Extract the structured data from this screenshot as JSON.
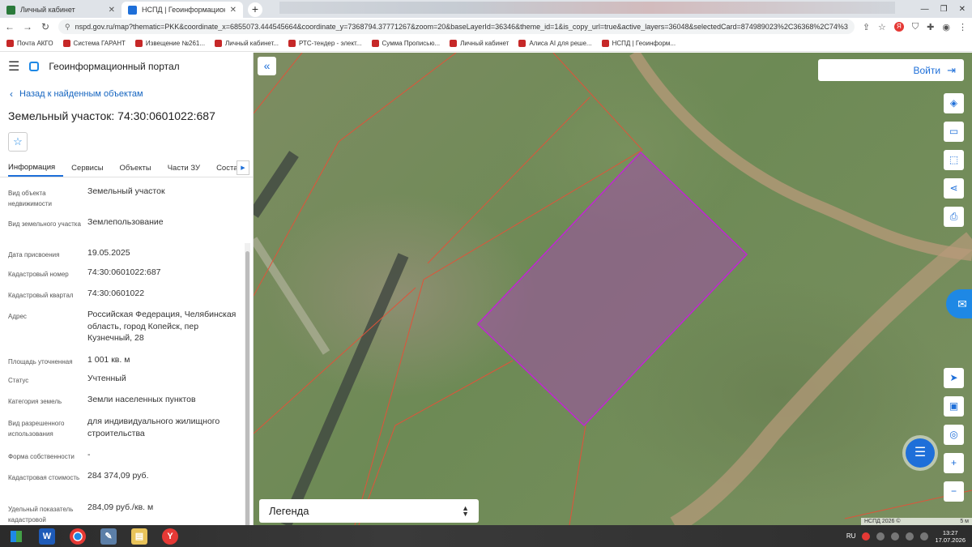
{
  "browser": {
    "tabs": [
      {
        "label": "Личный кабинет",
        "active": false
      },
      {
        "label": "НСПД | Геоинформационный п",
        "active": true
      }
    ],
    "url": "nspd.gov.ru/map?thematic=PKK&coordinate_x=6855073.444545664&coordinate_y=7368794.37771267&zoom=20&baseLayerId=36346&theme_id=1&is_copy_url=true&active_layers=36048&selectedCard=874989023%2C36368%2C74%3A30...",
    "bookmarks": [
      "Почта АКГО",
      "Система ГАРАНТ",
      "Извещение №261...",
      "Личный кабинет...",
      "РТС-тендер - элект...",
      "Сумма Прописью...",
      "Личный кабинет",
      "Алиса AI для реше...",
      "НСПД | Геоинформ..."
    ]
  },
  "app": {
    "title": "Геоинформационный портал",
    "back_label": "Назад к найденным объектам",
    "object_title": "Земельный участок: 74:30:0601022:687",
    "tabs": [
      "Информация",
      "Сервисы",
      "Объекты",
      "Части ЗУ",
      "Состав"
    ]
  },
  "properties": [
    {
      "label": "Вид объекта недвижимости",
      "value": "Земельный участок"
    },
    {
      "label": "Вид земельного участка",
      "value": "Землепользование"
    },
    {
      "label": "Дата присвоения",
      "value": "19.05.2025"
    },
    {
      "label": "Кадастровый номер",
      "value": "74:30:0601022:687"
    },
    {
      "label": "Кадастровый квартал",
      "value": "74:30:0601022"
    },
    {
      "label": "Адрес",
      "value": "Российская Федерация, Челябинская область, город Копейск, пер Кузнечный, 28"
    },
    {
      "label": "Площадь уточненная",
      "value": "1 001 кв. м"
    },
    {
      "label": "Статус",
      "value": "Учтенный"
    },
    {
      "label": "Категория земель",
      "value": "Земли населенных пунктов"
    },
    {
      "label": "Вид разрешенного использования",
      "value": "для индивидуального жилищного строительства"
    },
    {
      "label": "Форма собственности",
      "value": "-"
    },
    {
      "label": "Кадастровая стоимость",
      "value": "284 374,09 руб."
    },
    {
      "label": "Удельный показатель кадастровой",
      "value": "284,09 руб./кв. м"
    }
  ],
  "map": {
    "login_label": "Войти",
    "legend_label": "Легенда",
    "attribution": "НСПД 2026 ©",
    "scale_label": "5 м",
    "colors": {
      "parcel_fill": "#a04fa8",
      "parcel_stroke": "#c026d3",
      "boundary": "#e0533a",
      "road": "#b89a7a"
    },
    "tools": [
      "layers-icon",
      "ruler-icon",
      "select-icon",
      "share-icon",
      "print-icon",
      "locate-icon",
      "basemap-icon",
      "gps-icon",
      "zoom-in-icon",
      "zoom-out-icon"
    ]
  },
  "taskbar": {
    "lang": "RU",
    "time": "13:27",
    "date": "17.07.2026"
  }
}
